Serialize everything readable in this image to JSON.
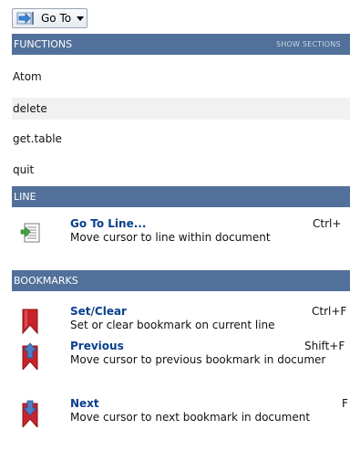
{
  "toolbar": {
    "goto_label": "Go To"
  },
  "functions_section": {
    "title": "FUNCTIONS",
    "show_sections_label": "SHOW SECTIONS",
    "items": [
      {
        "label": "Atom"
      },
      {
        "label": "delete"
      },
      {
        "label": "get.table"
      },
      {
        "label": "quit"
      }
    ]
  },
  "line_section": {
    "title": "LINE",
    "commands": [
      {
        "title": "Go To Line...",
        "description": "Move cursor to line within document",
        "shortcut": "Ctrl+",
        "icon": "goto-line-icon"
      }
    ]
  },
  "bookmarks_section": {
    "title": "BOOKMARKS",
    "commands": [
      {
        "title": "Set/Clear",
        "description": "Set or clear bookmark on current line",
        "shortcut": "Ctrl+F",
        "icon": "bookmark-icon"
      },
      {
        "title": "Previous",
        "description": "Move cursor to previous bookmark in documer",
        "shortcut": "Shift+F",
        "icon": "bookmark-previous-icon"
      },
      {
        "title": "Next",
        "description": "Move cursor to next bookmark in document",
        "shortcut": "F",
        "icon": "bookmark-next-icon"
      }
    ]
  },
  "colors": {
    "header_bg": "#52719a",
    "command_title": "#0a3f8d",
    "bookmark_red": "#c8232c",
    "arrow_blue": "#4a7fc8"
  }
}
